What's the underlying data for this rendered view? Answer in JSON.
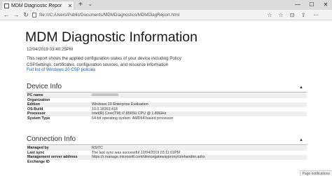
{
  "browser": {
    "tab_title": "MDM Diagnostic Repor",
    "tab_close": "✕",
    "new_tab": "+",
    "tab_list": "⌄",
    "window_controls": [
      "—",
      "☐",
      "✕"
    ],
    "url": "file:///C:/Users/Public/Documents/MDMDiagnostics/MDMDiagReport.html",
    "nav": {
      "back": "←",
      "forward": "→",
      "refresh": "↻"
    },
    "tools": {
      "favorite": "☆",
      "favorites_bar": "☆",
      "reading": "⊡",
      "share": "⇧",
      "more": "⋯"
    }
  },
  "page": {
    "title": "MDM Diagnostic Information",
    "timestamp": "12/04/2019 03:40:25PM",
    "description": "This report shows the applied configuration states of your device including Policy CSPSettings, certificates, configuration sources, and resource information",
    "csp_link": "Full list of Windows 10 CSP policies"
  },
  "device_info": {
    "title": "Device Info",
    "caret": "▲",
    "rows": [
      {
        "key": "PC name",
        "value": "",
        "redacted": true
      },
      {
        "key": "Organization",
        "value": ""
      },
      {
        "key": "Edition",
        "value": "Windows 10 Enterprise Evaluation"
      },
      {
        "key": "OS Build",
        "value": "10.0.18363.418"
      },
      {
        "key": "Processor",
        "value": "Intel(R) Core(TM) i7-8565U CPU @ 1.80GHz"
      },
      {
        "key": "System Type",
        "value": "64-bit operating system. AMD64-based processor"
      }
    ]
  },
  "connection_info": {
    "title": "Connection Info",
    "caret": "▲",
    "rows": [
      {
        "key": "Managed by",
        "value": "RSITC"
      },
      {
        "key": "Last sync",
        "value": "The last sync was successful 12/04/2019 03:11:01PM"
      },
      {
        "key": "Management server address",
        "value": "https://r.manage.microsoft.com/devicegatewayproxy/cimhandler.ashx"
      },
      {
        "key": "Exchange ID",
        "value": ""
      }
    ]
  },
  "status_tip": "Page notifications"
}
